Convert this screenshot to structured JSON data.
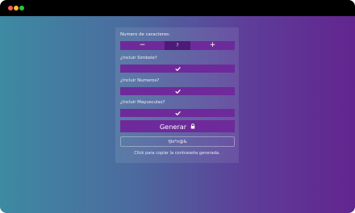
{
  "form": {
    "length_label": "Numero de caracteres:",
    "length": {
      "minus_label": "−",
      "value": "?",
      "plus_label": "+"
    },
    "symbols_label": "¿Incluir Simbolo?",
    "numbers_label": "¿Incluir Numeros?",
    "uppercase_label": "¿Incluir Mayusculas?",
    "generate_label": "Generar",
    "password_value": "fjlo*n@&",
    "copy_hint": "Click para copiar la contraseña generada."
  },
  "icons": {
    "checks": "check-icon",
    "lock": "lock-icon"
  },
  "colors": {
    "accent": "#6e2a9a",
    "counter_value_bg": "#4e1a78",
    "gradient_start": "#3d8aa3",
    "gradient_end": "#62258f"
  }
}
